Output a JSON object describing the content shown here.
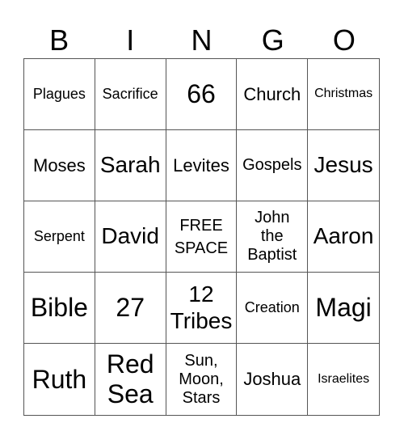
{
  "header": [
    "B",
    "I",
    "N",
    "G",
    "O"
  ],
  "cells": [
    [
      "Plagues",
      "Sacrifice",
      "66",
      "Church",
      "Christmas"
    ],
    [
      "Moses",
      "Sarah",
      "Levites",
      "Gospels",
      "Jesus"
    ],
    [
      "Serpent",
      "David",
      "FREE SPACE",
      "John the Baptist",
      "Aaron"
    ],
    [
      "Bible",
      "27",
      "12 Tribes",
      "Creation",
      "Magi"
    ],
    [
      "Ruth",
      "Red Sea",
      "Sun, Moon, Stars",
      "Joshua",
      "Israelites"
    ]
  ]
}
